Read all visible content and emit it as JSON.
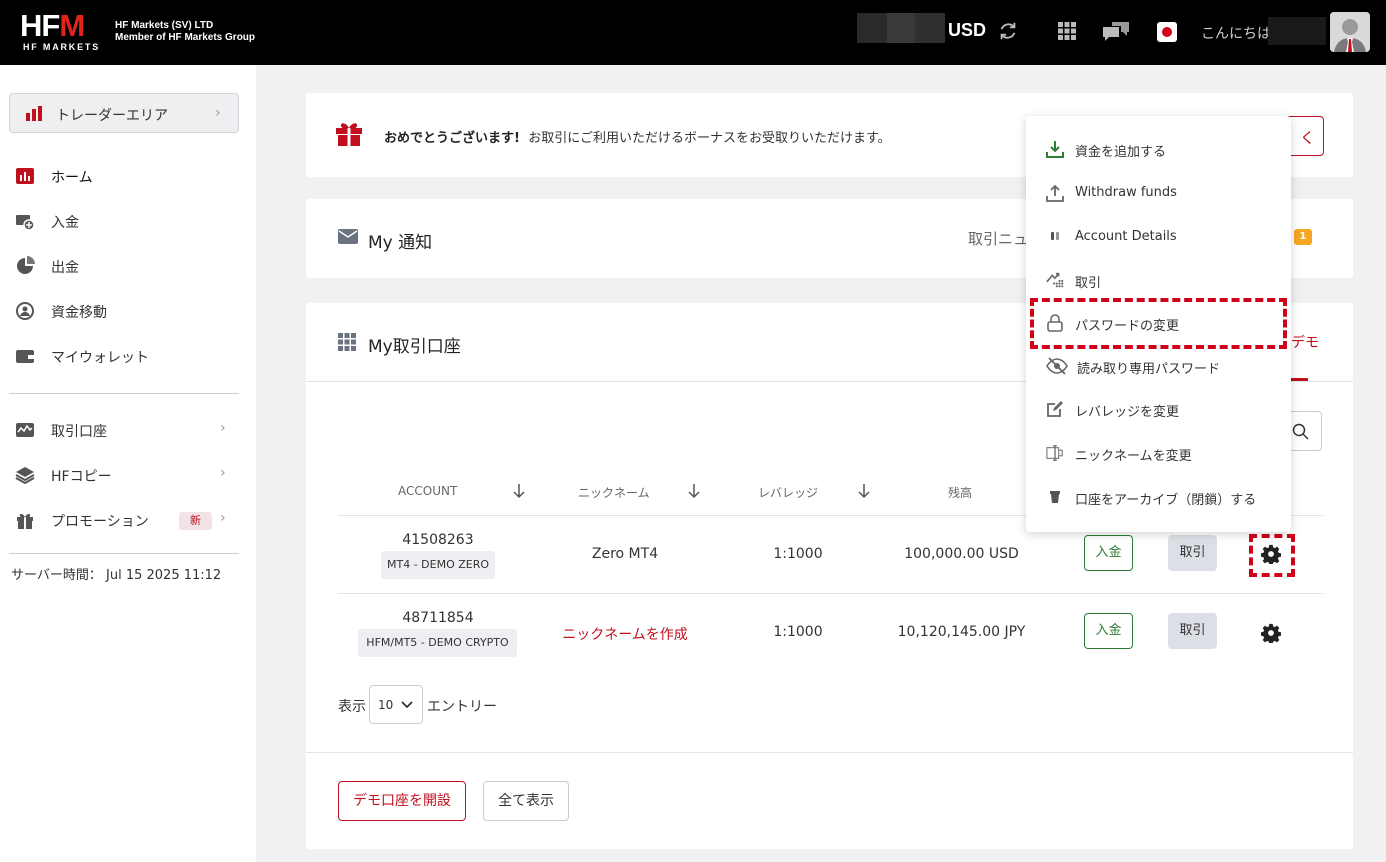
{
  "header": {
    "logo_main": "HF",
    "logo_m": "M",
    "logo_sub": "HF MARKETS",
    "company_line1": "HF Markets (SV) LTD",
    "company_line2": "Member of HF Markets Group",
    "currency": "USD",
    "greeting": "こんにちは",
    "icons": [
      "refresh-icon",
      "apps-grid-icon",
      "chat-icon",
      "japan-flag-icon",
      "user-avatar"
    ]
  },
  "sidebar": {
    "trader_area": "トレーダーエリア",
    "items": [
      {
        "label": "ホーム",
        "icon": "bar-chart-icon"
      },
      {
        "label": "入金",
        "icon": "deposit-icon"
      },
      {
        "label": "出金",
        "icon": "withdraw-icon"
      },
      {
        "label": "資金移動",
        "icon": "transfer-icon"
      },
      {
        "label": "マイウォレット",
        "icon": "wallet-icon"
      }
    ],
    "items2": [
      {
        "label": "取引口座",
        "icon": "trading-account-icon"
      },
      {
        "label": "HFコピー",
        "icon": "layers-icon"
      },
      {
        "label": "プロモーション",
        "icon": "gift-icon",
        "badge": "新"
      }
    ],
    "server_time_label": "サーバー時間：",
    "server_time_value": "Jul 15 2025 11:12"
  },
  "bonus_banner": {
    "title": "おめでとうございます!",
    "text": "お取引にご利用いただけるボーナスをお受取りいただけます。",
    "button_fragment": "く"
  },
  "notifications": {
    "title": "My 通知",
    "tab_label": "取引ニュ",
    "badge": "1"
  },
  "accounts": {
    "title": "My取引口座",
    "tab_fragment": "デモ",
    "columns": [
      "ACCOUNT",
      "ニックネーム",
      "レバレッジ",
      "残高"
    ],
    "rows": [
      {
        "account": "41508263",
        "type": "MT4 - DEMO ZERO",
        "nickname": "Zero MT4",
        "leverage": "1:1000",
        "balance": "100,000.00 USD",
        "deposit": "入金",
        "trade": "取引"
      },
      {
        "account": "48711854",
        "type": "HFM/MT5 - DEMO CRYPTO",
        "nickname": "ニックネームを作成",
        "leverage": "1:1000",
        "balance": "10,120,145.00 JPY",
        "deposit": "入金",
        "trade": "取引"
      }
    ],
    "show_label": "表示",
    "entries_value": "10",
    "entries_label": "エントリー",
    "open_demo": "デモ口座を開設",
    "show_all": "全て表示"
  },
  "dropdown": {
    "items": [
      {
        "label": "資金を追加する",
        "icon": "download-icon"
      },
      {
        "label": "Withdraw funds",
        "icon": "upload-icon"
      },
      {
        "label": "Account Details",
        "icon": "details-icon"
      },
      {
        "label": "取引",
        "icon": "trade-icon"
      },
      {
        "label": "パスワードの変更",
        "icon": "lock-icon"
      },
      {
        "label": "読み取り専用パスワード",
        "icon": "eye-slash-icon"
      },
      {
        "label": "レバレッジを変更",
        "icon": "edit-icon"
      },
      {
        "label": "ニックネームを変更",
        "icon": "rename-icon"
      },
      {
        "label": "口座をアーカイブ（閉鎖）する",
        "icon": "trash-icon"
      }
    ]
  },
  "colors": {
    "brand_red": "#c0101d",
    "highlight_red": "#d0021b",
    "deposit_green": "#2e7d32",
    "badge_orange": "#f5a623"
  }
}
